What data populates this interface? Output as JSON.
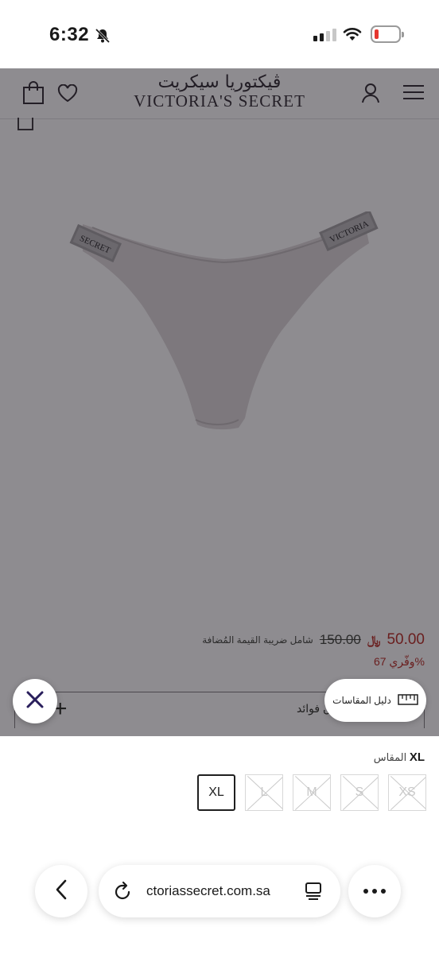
{
  "status_bar": {
    "time": "6:32"
  },
  "header": {
    "brand_arabic": "ڤيكتوريا سيكريت",
    "brand_english": "VICTORIA'S SECRET"
  },
  "product": {
    "price_now": "50.00",
    "currency_symbol": "﷼",
    "price_was": "150.00",
    "tax_note": "شامل ضريبة القيمة المُضافة",
    "savings": "وفّري 67%",
    "benefits_label": "ون فوائد",
    "band_text": "VICTORIA",
    "band_text_left": "SECRET"
  },
  "size_guide": {
    "label": "دليل المقاسات"
  },
  "size_selector": {
    "label": "المقاس",
    "selected": "XL",
    "options": [
      {
        "label": "XL",
        "available": true
      },
      {
        "label": "L",
        "available": false
      },
      {
        "label": "M",
        "available": false
      },
      {
        "label": "S",
        "available": false
      },
      {
        "label": "XS",
        "available": false
      }
    ]
  },
  "browser": {
    "url": "ctoriassecret.com.sa"
  },
  "colors": {
    "overlay": "#8e8c90",
    "price": "#6a1e1e",
    "close_icon": "#2a1f5c",
    "battery_low": "#e5362f"
  },
  "icons": [
    "bell-slash-icon",
    "signal-icon",
    "wifi-icon",
    "battery-icon",
    "bag-icon",
    "heart-icon",
    "user-icon",
    "menu-icon",
    "close-icon",
    "ruler-icon",
    "back-icon",
    "reload-icon",
    "reader-icon",
    "more-icon",
    "plus-icon"
  ]
}
